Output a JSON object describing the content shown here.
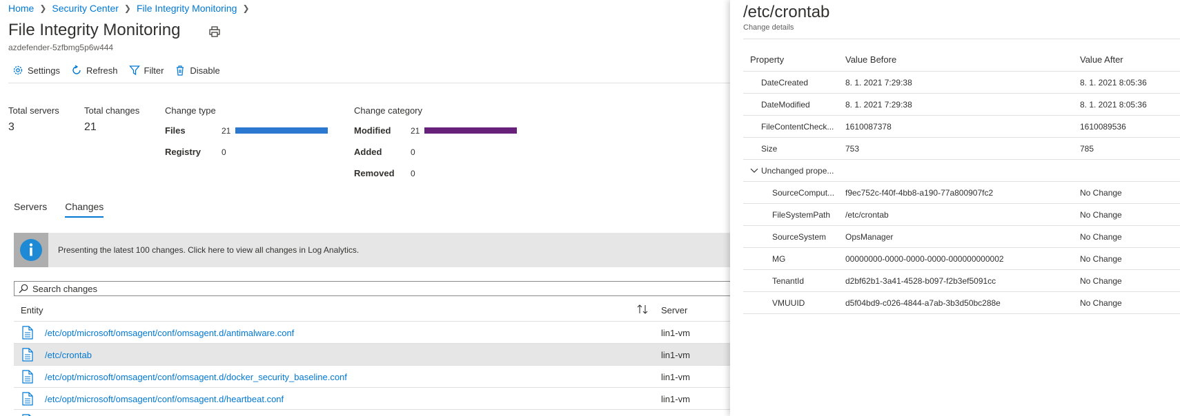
{
  "breadcrumb": [
    "Home",
    "Security Center",
    "File Integrity Monitoring"
  ],
  "page": {
    "title": "File Integrity Monitoring",
    "subtitle": "azdefender-5zfbmg5p6w444"
  },
  "toolbar": {
    "settings": "Settings",
    "refresh": "Refresh",
    "filter": "Filter",
    "disable": "Disable"
  },
  "stats": {
    "total_servers_label": "Total servers",
    "total_servers": "3",
    "total_changes_label": "Total changes",
    "total_changes": "21"
  },
  "change_type": {
    "title": "Change type",
    "items": [
      {
        "name": "Files",
        "count": "21",
        "fraction": 1.0
      },
      {
        "name": "Registry",
        "count": "0",
        "fraction": 0
      }
    ],
    "bar_color": "#2b78d0"
  },
  "change_category": {
    "title": "Change category",
    "items": [
      {
        "name": "Modified",
        "count": "21",
        "fraction": 1.0
      },
      {
        "name": "Added",
        "count": "0",
        "fraction": 0
      },
      {
        "name": "Removed",
        "count": "0",
        "fraction": 0
      }
    ],
    "bar_color": "#68217a"
  },
  "tabs": [
    {
      "label": "Servers",
      "active": false
    },
    {
      "label": "Changes",
      "active": true
    }
  ],
  "info_banner": {
    "text": "Presenting the latest 100 changes. Click here to view all changes in Log Analytics.",
    "icon": "info-icon"
  },
  "search": {
    "placeholder": "Search changes",
    "value": ""
  },
  "grid": {
    "columns": {
      "entity": "Entity",
      "server": "Server"
    },
    "rows": [
      {
        "entity": "/etc/opt/microsoft/omsagent/conf/omsagent.d/antimalware.conf",
        "server": "lin1-vm",
        "selected": false
      },
      {
        "entity": "/etc/crontab",
        "server": "lin1-vm",
        "selected": true
      },
      {
        "entity": "/etc/opt/microsoft/omsagent/conf/omsagent.d/docker_security_baseline.conf",
        "server": "lin1-vm",
        "selected": false
      },
      {
        "entity": "/etc/opt/microsoft/omsagent/conf/omsagent.d/heartbeat.conf",
        "server": "lin1-vm",
        "selected": false
      }
    ]
  },
  "blade": {
    "title": "/etc/crontab",
    "subtitle": "Change details",
    "columns": {
      "property": "Property",
      "before": "Value Before",
      "after": "Value After"
    },
    "changed": [
      {
        "property": "DateCreated",
        "before": "8. 1. 2021 7:29:38",
        "after": "8. 1. 2021 8:05:36"
      },
      {
        "property": "DateModified",
        "before": "8. 1. 2021 7:29:38",
        "after": "8. 1. 2021 8:05:36"
      },
      {
        "property": "FileContentCheck...",
        "before": "1610087378",
        "after": "1610089536"
      },
      {
        "property": "Size",
        "before": "753",
        "after": "785"
      }
    ],
    "unchanged_group": "Unchanged prope...",
    "unchanged": [
      {
        "property": "SourceComput...",
        "before": "f9ec752c-f40f-4bb8-a190-77a800907fc2",
        "after": "No Change"
      },
      {
        "property": "FileSystemPath",
        "before": "/etc/crontab",
        "after": "No Change"
      },
      {
        "property": "SourceSystem",
        "before": "OpsManager",
        "after": "No Change"
      },
      {
        "property": "MG",
        "before": "00000000-0000-0000-0000-000000000002",
        "after": "No Change"
      },
      {
        "property": "TenantId",
        "before": "d2bf62b1-3a41-4528-b097-f2b3ef5091cc",
        "after": "No Change"
      },
      {
        "property": "VMUUID",
        "before": "d5f04bd9-c026-4844-a7ab-3b3d50bc288e",
        "after": "No Change"
      }
    ]
  },
  "colors": {
    "accent": "#0078d4",
    "selected_row": "#e6e6e6",
    "banner": "#e6e6e6"
  }
}
